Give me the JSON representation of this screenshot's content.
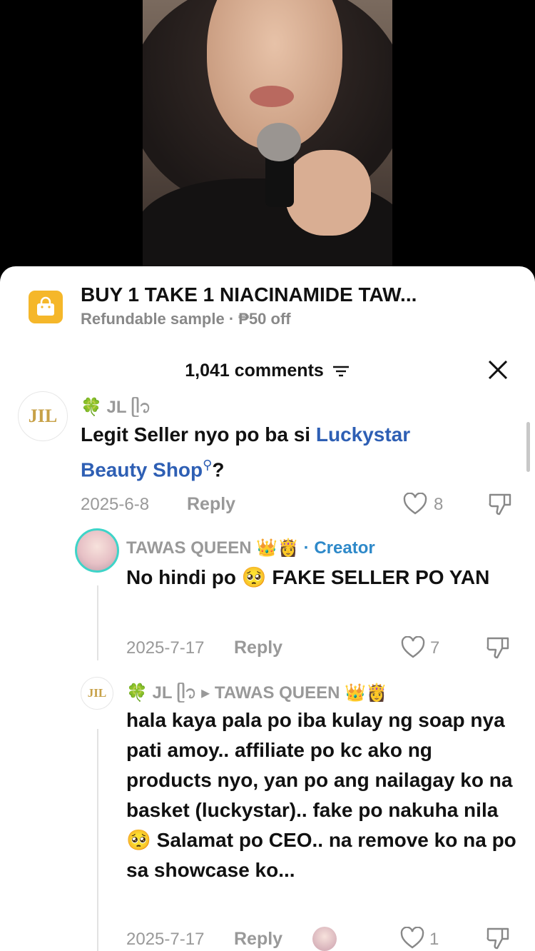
{
  "product": {
    "title": "BUY 1 TAKE 1 NIACINAMIDE TAW...",
    "subtitle": "Refundable sample · ₱50 off"
  },
  "comments_header": {
    "count": "1,041 comments"
  },
  "comments": [
    {
      "avatar": "JIL",
      "name": "🍀 JL ᥫ᭡",
      "text_before": "Legit Seller nyo po ba si ",
      "text_link": "Luckystar Beauty Shop",
      "text_after": "?",
      "date": "2025-6-8",
      "reply": "Reply",
      "likes": "8"
    },
    {
      "name": "TAWAS QUEEN 👑👸",
      "badge": " · Creator",
      "text": "No hindi po 🥺 FAKE SELLER PO YAN",
      "date": "2025-7-17",
      "reply": "Reply",
      "likes": "7"
    },
    {
      "avatar": "JIL",
      "name": "🍀 JL ᥫ᭡ ▸ TAWAS QUEEN 👑👸",
      "text": "hala kaya pala po iba kulay ng soap nya pati amoy.. affiliate po kc ako ng products nyo, yan po ang nailagay ko na basket (luckystar).. fake po nakuha nila 🥺 Salamat po CEO.. na remove ko na po sa showcase ko...",
      "date": "2025-7-17",
      "reply": "Reply",
      "likes": "1"
    }
  ],
  "colors": {
    "accent_link": "#2e5fb4",
    "creator": "#2e89c9",
    "bag": "#f5b72a"
  }
}
